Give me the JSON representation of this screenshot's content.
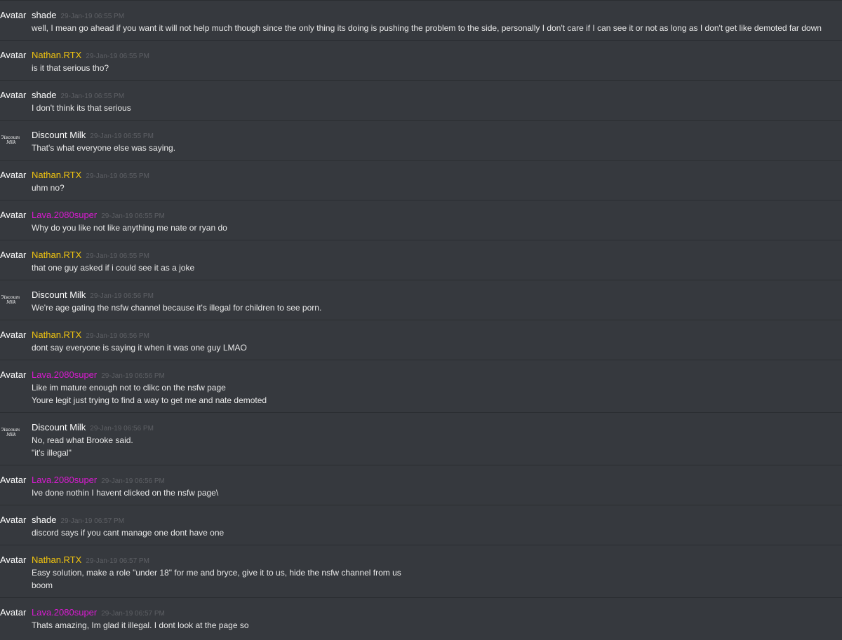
{
  "avatar_alt": "Avatar",
  "logo_text": [
    "Discount",
    "Milk"
  ],
  "colors": {
    "shade": "#ffffff",
    "nathan": "#f1c40f",
    "lava": "#d81bd0",
    "discount": "#ffffff"
  },
  "messages": [
    {
      "user": "shade",
      "color": "shade",
      "time": "29-Jan-19 06:55 PM",
      "avatar": "alt",
      "lines": [
        "well, I mean go ahead if you want it will not help much though since the only thing its doing is pushing the problem to the side, personally I don't care if I can see it or not as long as I don't get like demoted far down"
      ]
    },
    {
      "user": "Nathan.RTX",
      "color": "nathan",
      "time": "29-Jan-19 06:55 PM",
      "avatar": "alt",
      "lines": [
        "is it that serious tho?"
      ]
    },
    {
      "user": "shade",
      "color": "shade",
      "time": "29-Jan-19 06:55 PM",
      "avatar": "alt",
      "lines": [
        "I don't think its that serious"
      ]
    },
    {
      "user": "Discount Milk",
      "color": "discount",
      "time": "29-Jan-19 06:55 PM",
      "avatar": "logo",
      "lines": [
        "That's what everyone else was saying."
      ]
    },
    {
      "user": "Nathan.RTX",
      "color": "nathan",
      "time": "29-Jan-19 06:55 PM",
      "avatar": "alt",
      "lines": [
        "uhm no?"
      ]
    },
    {
      "user": "Lava.2080super",
      "color": "lava",
      "time": "29-Jan-19 06:55 PM",
      "avatar": "alt",
      "lines": [
        "Why do you like not like anything me nate or ryan do"
      ]
    },
    {
      "user": "Nathan.RTX",
      "color": "nathan",
      "time": "29-Jan-19 06:55 PM",
      "avatar": "alt",
      "lines": [
        "that one guy asked if i could see it as a joke"
      ]
    },
    {
      "user": "Discount Milk",
      "color": "discount",
      "time": "29-Jan-19 06:56 PM",
      "avatar": "logo",
      "lines": [
        "We're age gating the nsfw channel because it's illegal for children to see porn."
      ]
    },
    {
      "user": "Nathan.RTX",
      "color": "nathan",
      "time": "29-Jan-19 06:56 PM",
      "avatar": "alt",
      "lines": [
        "dont say everyone is saying it when it was one guy LMAO"
      ]
    },
    {
      "user": "Lava.2080super",
      "color": "lava",
      "time": "29-Jan-19 06:56 PM",
      "avatar": "alt",
      "lines": [
        "Like im mature enough not to clikc on the nsfw page",
        "Youre legit just trying to find a way to get me and nate demoted"
      ]
    },
    {
      "user": "Discount Milk",
      "color": "discount",
      "time": "29-Jan-19 06:56 PM",
      "avatar": "logo",
      "lines": [
        "No, read what Brooke said.",
        "\"it's illegal\""
      ]
    },
    {
      "user": "Lava.2080super",
      "color": "lava",
      "time": "29-Jan-19 06:56 PM",
      "avatar": "alt",
      "lines": [
        "Ive done nothin I havent clicked on the nsfw page\\"
      ]
    },
    {
      "user": "shade",
      "color": "shade",
      "time": "29-Jan-19 06:57 PM",
      "avatar": "alt",
      "lines": [
        "discord says if you cant manage one dont have one"
      ]
    },
    {
      "user": "Nathan.RTX",
      "color": "nathan",
      "time": "29-Jan-19 06:57 PM",
      "avatar": "alt",
      "lines": [
        "Easy solution, make a role \"under 18\" for me and bryce, give it to us, hide the nsfw channel from us",
        "boom"
      ]
    },
    {
      "user": "Lava.2080super",
      "color": "lava",
      "time": "29-Jan-19 06:57 PM",
      "avatar": "alt",
      "lines": [
        "Thats amazing, Im glad it illegal. I dont look at the page so"
      ]
    }
  ]
}
